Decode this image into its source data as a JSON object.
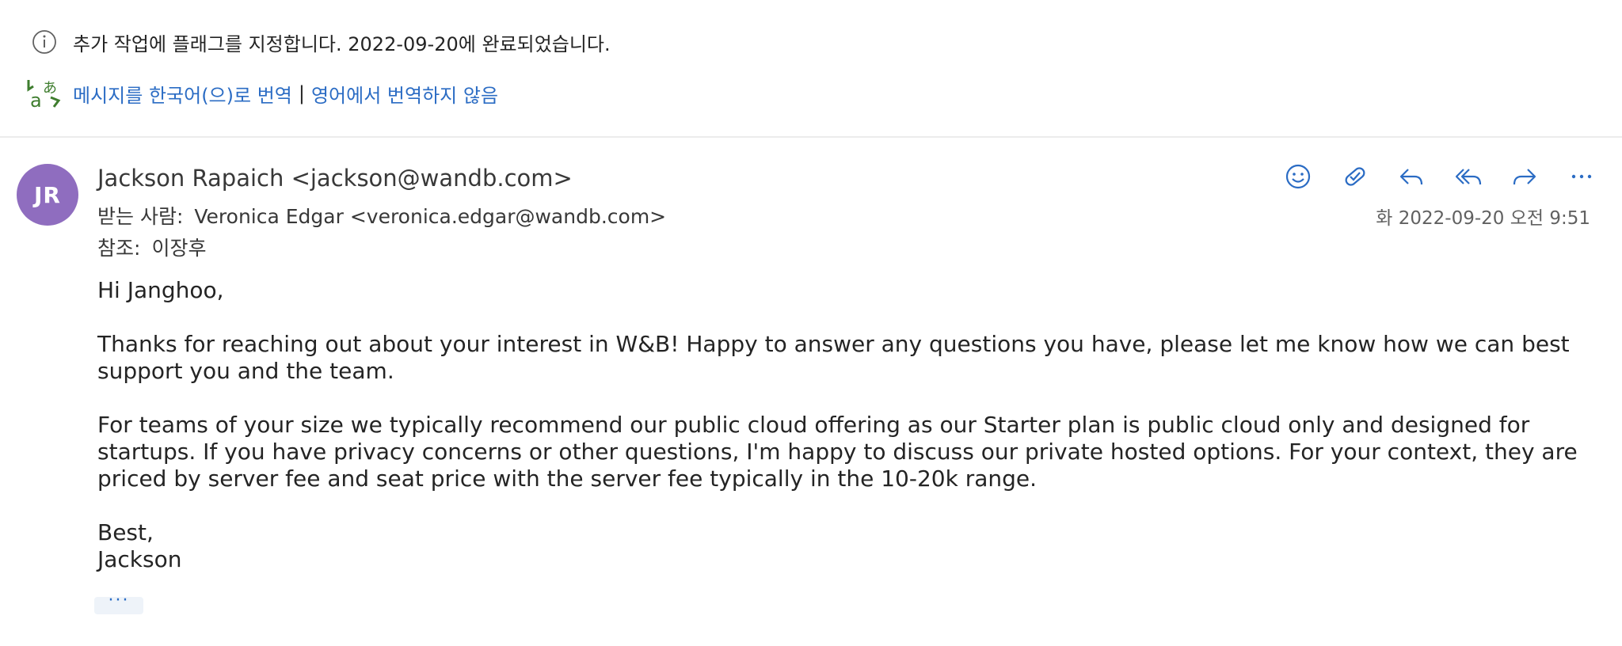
{
  "info_bar": {
    "icon": "info-icon",
    "text": "추가 작업에 플래그를 지정합니다. 2022-09-20에 완료되었습니다."
  },
  "translate_bar": {
    "icon": "translate-icon",
    "translate_link": "메시지를 한국어(으)로 번역",
    "separator": "|",
    "never_link": "영어에서 번역하지 않음"
  },
  "message": {
    "avatar_initials": "JR",
    "avatar_color": "#8f6dbf",
    "sender": "Jackson Rapaich <jackson@wandb.com>",
    "to_label": "받는 사람:",
    "to_value": "Veronica Edgar <veronica.edgar@wandb.com>",
    "cc_label": "참조:",
    "cc_value": "이장후",
    "date": "화 2022-09-20 오전 9:51",
    "actions": [
      {
        "name": "react-icon"
      },
      {
        "name": "flag-complete-icon"
      },
      {
        "name": "reply-icon"
      },
      {
        "name": "reply-all-icon"
      },
      {
        "name": "forward-icon"
      },
      {
        "name": "more-icon"
      }
    ],
    "body": {
      "greeting": "Hi Janghoo,",
      "paragraph1": "Thanks for reaching out about your interest in W&B! Happy to answer any questions you have, please let me know how we can best support you and the team.",
      "paragraph2": "For teams of your size we typically recommend our public cloud offering as our Starter plan is public cloud only and designed for startups. If you have privacy concerns or other questions, I'm happy to discuss our private hosted options. For your context, they are priced by server fee and seat price with the server fee typically in the 10-20k range.",
      "signoff": "Best,",
      "signature": "Jackson"
    },
    "show_more_label": "···"
  },
  "colors": {
    "link": "#2b6cc4",
    "icon_green": "#3e7d2e",
    "text": "#242424",
    "meta_text": "#616161"
  }
}
